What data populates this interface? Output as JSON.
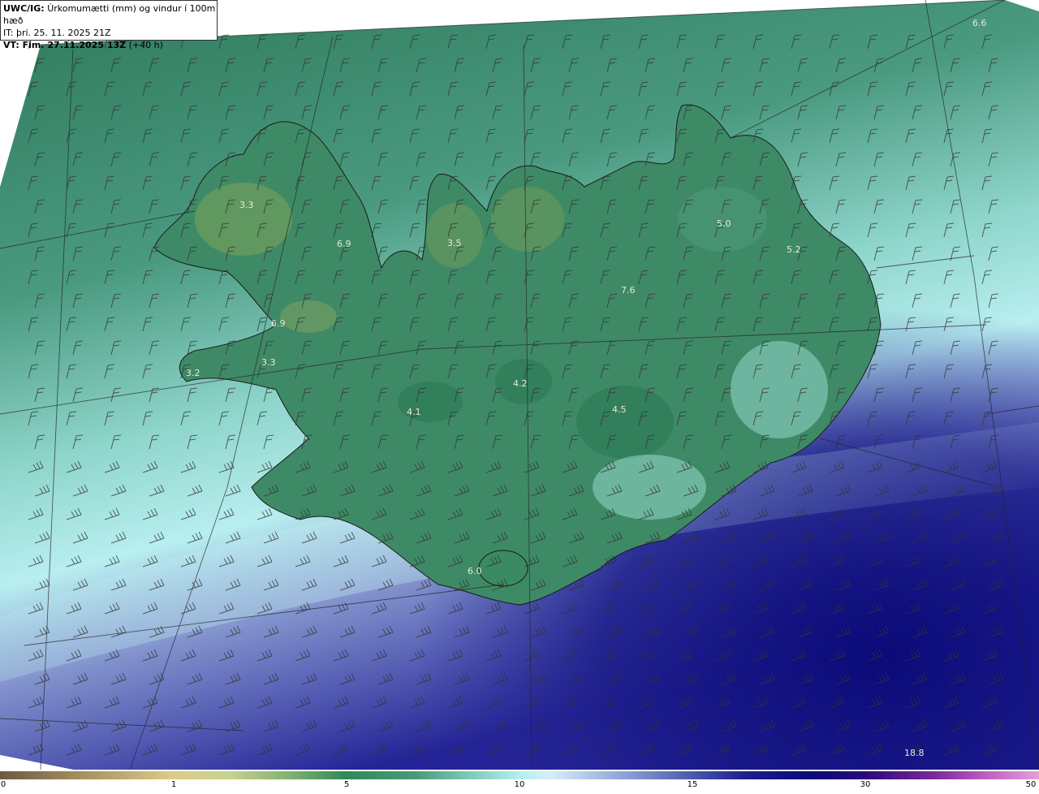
{
  "header": {
    "model": "UWC/IG:",
    "title": "Úrkomumætti (mm) og vindur í 100m hæð",
    "init_time": "IT: þri. 25. 11. 2025 21Z",
    "valid_prefix": "VT: Fim. 27.11.2025 13Z",
    "valid_suffix": "(+40 h)"
  },
  "map_labels": [
    "6.6",
    "3.3",
    "6.9",
    "3.5",
    "5.0",
    "5.2",
    "7.6",
    "6.9",
    "3.3",
    "3.2",
    "4.2",
    "4.1",
    "4.5",
    "6.0",
    "18.8"
  ],
  "colorbar": {
    "ticks": [
      "0",
      "1",
      "5",
      "10",
      "15",
      "30",
      "50"
    ]
  },
  "colors": {
    "land_green": "#2f7a55",
    "sea_teal": "#5aa88e",
    "light_cyan": "#b7eeee",
    "deep_blue": "#14147e"
  }
}
